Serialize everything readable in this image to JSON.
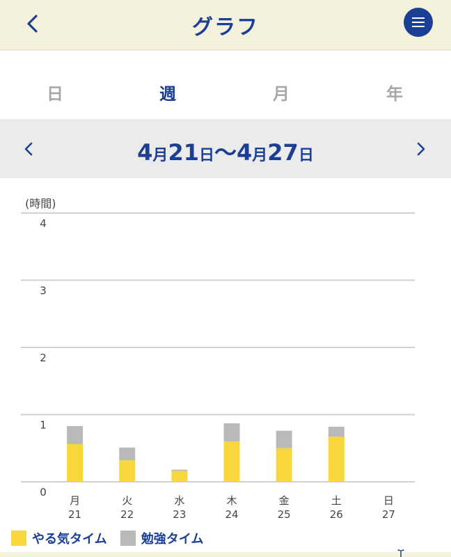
{
  "header": {
    "title": "グラフ"
  },
  "tabs": [
    {
      "label": "日",
      "active": false
    },
    {
      "label": "週",
      "active": true
    },
    {
      "label": "月",
      "active": false
    },
    {
      "label": "年",
      "active": false
    }
  ],
  "range": {
    "m1": "4",
    "u1": "月",
    "d1": "21",
    "u2": "日",
    "sep": "〜",
    "m2": "4",
    "u3": "月",
    "d2": "27",
    "u4": "日"
  },
  "colors": {
    "primary": "#1b3f94",
    "yellow": "#f7d73c",
    "gray": "#b9b9b9"
  },
  "chart_data": {
    "type": "bar",
    "stacked": true,
    "ylabel": "(時間)",
    "ylim": [
      0,
      4
    ],
    "yticks": [
      "0",
      "1",
      "2",
      "3",
      "4"
    ],
    "categories": [
      {
        "day": "月",
        "date": "21"
      },
      {
        "day": "火",
        "date": "22"
      },
      {
        "day": "水",
        "date": "23"
      },
      {
        "day": "木",
        "date": "24"
      },
      {
        "day": "金",
        "date": "25"
      },
      {
        "day": "土",
        "date": "26"
      },
      {
        "day": "日",
        "date": "27"
      }
    ],
    "series": [
      {
        "name": "やる気タイム",
        "color": "#f7d73c",
        "values": [
          0.56,
          0.32,
          0.16,
          0.6,
          0.5,
          0.67,
          0
        ]
      },
      {
        "name": "勉強タイム",
        "color": "#b9b9b9",
        "values": [
          0.27,
          0.19,
          0.02,
          0.27,
          0.26,
          0.15,
          0
        ]
      }
    ],
    "grid": true
  }
}
